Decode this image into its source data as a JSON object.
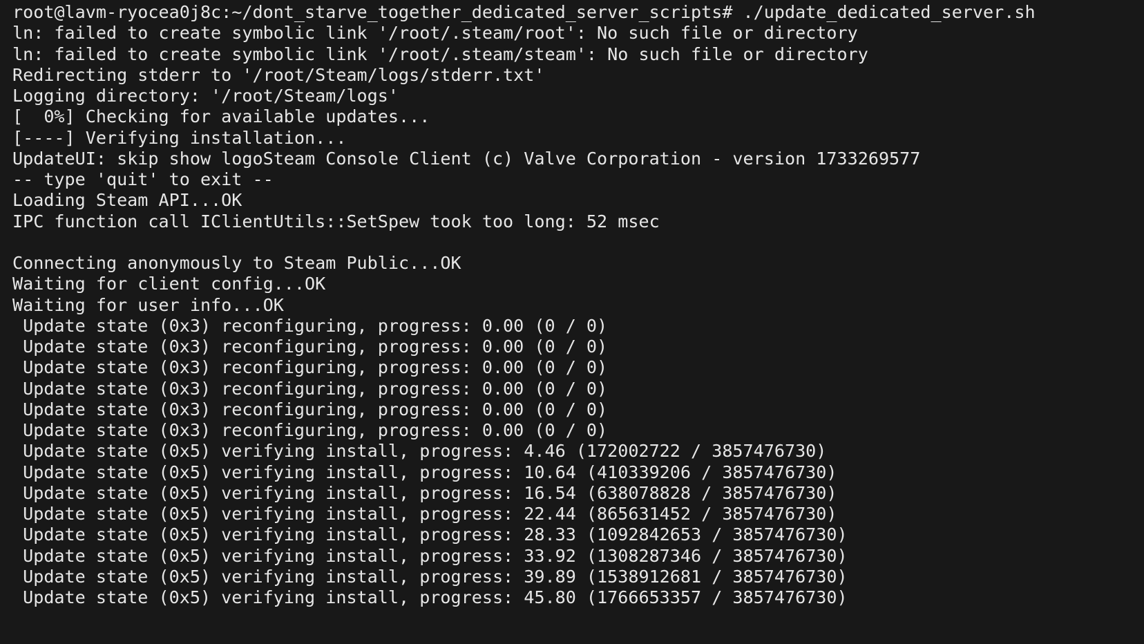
{
  "terminal": {
    "lines": [
      "root@lavm-ryocea0j8c:~/dont_starve_together_dedicated_server_scripts# ./update_dedicated_server.sh",
      "ln: failed to create symbolic link '/root/.steam/root': No such file or directory",
      "ln: failed to create symbolic link '/root/.steam/steam': No such file or directory",
      "Redirecting stderr to '/root/Steam/logs/stderr.txt'",
      "Logging directory: '/root/Steam/logs'",
      "[  0%] Checking for available updates...",
      "[----] Verifying installation...",
      "UpdateUI: skip show logoSteam Console Client (c) Valve Corporation - version 1733269577",
      "-- type 'quit' to exit --",
      "Loading Steam API...OK",
      "IPC function call IClientUtils::SetSpew took too long: 52 msec",
      "",
      "Connecting anonymously to Steam Public...OK",
      "Waiting for client config...OK",
      "Waiting for user info...OK",
      " Update state (0x3) reconfiguring, progress: 0.00 (0 / 0)",
      " Update state (0x3) reconfiguring, progress: 0.00 (0 / 0)",
      " Update state (0x3) reconfiguring, progress: 0.00 (0 / 0)",
      " Update state (0x3) reconfiguring, progress: 0.00 (0 / 0)",
      " Update state (0x3) reconfiguring, progress: 0.00 (0 / 0)",
      " Update state (0x3) reconfiguring, progress: 0.00 (0 / 0)",
      " Update state (0x5) verifying install, progress: 4.46 (172002722 / 3857476730)",
      " Update state (0x5) verifying install, progress: 10.64 (410339206 / 3857476730)",
      " Update state (0x5) verifying install, progress: 16.54 (638078828 / 3857476730)",
      " Update state (0x5) verifying install, progress: 22.44 (865631452 / 3857476730)",
      " Update state (0x5) verifying install, progress: 28.33 (1092842653 / 3857476730)",
      " Update state (0x5) verifying install, progress: 33.92 (1308287346 / 3857476730)",
      " Update state (0x5) verifying install, progress: 39.89 (1538912681 / 3857476730)",
      " Update state (0x5) verifying install, progress: 45.80 (1766653357 / 3857476730)"
    ]
  },
  "colors": {
    "background": "#181818",
    "foreground": "#e6e6e6"
  }
}
